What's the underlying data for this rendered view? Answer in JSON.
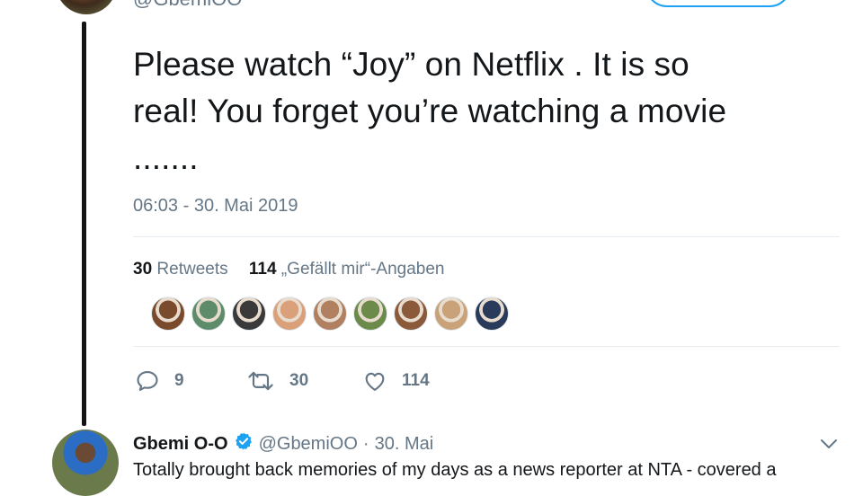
{
  "top_tweet": {
    "handle": "@GbemiOO",
    "text": "Please watch “Joy” on Netflix . It is so\nreal! You forget you’re watching a movie\n.......",
    "timestamp": "06:03 - 30. Mai 2019",
    "stats": {
      "retweets_count": "30",
      "retweets_label": "Retweets",
      "likes_count": "114",
      "likes_label": "„Gefällt mir“-Angaben"
    },
    "likers": [
      {
        "name": "liker-1",
        "color": "#7a4a2c"
      },
      {
        "name": "liker-2",
        "color": "#5e8c6a"
      },
      {
        "name": "liker-3",
        "color": "#3a3a3a"
      },
      {
        "name": "liker-4",
        "color": "#d9a07a"
      },
      {
        "name": "liker-5",
        "color": "#b08060"
      },
      {
        "name": "liker-6",
        "color": "#6c8a4a"
      },
      {
        "name": "liker-7",
        "color": "#8a5a3a"
      },
      {
        "name": "liker-8",
        "color": "#c9a27a"
      },
      {
        "name": "liker-9",
        "color": "#2a3a5a"
      }
    ],
    "actions": {
      "replies": "9",
      "retweets": "30",
      "likes": "114"
    }
  },
  "reply_tweet": {
    "name": "Gbemi O-O",
    "handle": "@GbemiOO",
    "separator": "·",
    "date": "30. Mai",
    "text": "Totally brought back memories of my days as a news reporter at NTA - covered a"
  },
  "colors": {
    "accent": "#1da1f2",
    "muted": "#657786",
    "text": "#14171a"
  }
}
